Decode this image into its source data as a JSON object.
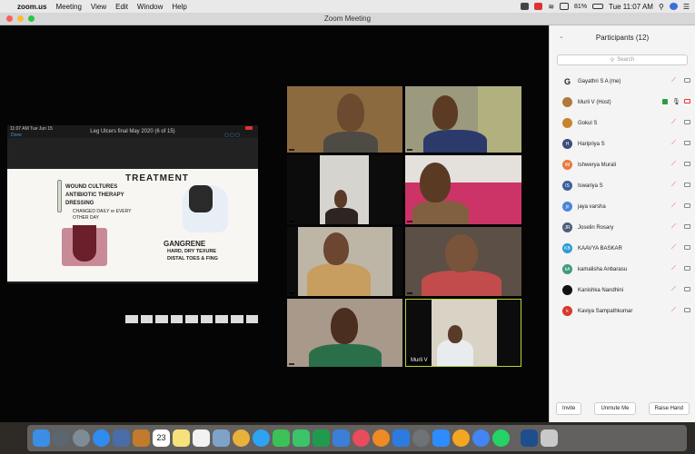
{
  "menubar": {
    "apple": "",
    "app_name": "zoom.us",
    "menus": [
      "Meeting",
      "View",
      "Edit",
      "Window",
      "Help"
    ],
    "battery": "81%",
    "clock": "Tue 11:07 AM"
  },
  "window": {
    "title": "Zoom Meeting"
  },
  "share": {
    "bar_left": "11:07 AM  Tue Jun 15",
    "bar_title": "Leg Ulcers final May 2020 (6 of 15)",
    "done_label": "Done",
    "slide": {
      "heading": "TREATMENT",
      "bullets": [
        "WOUND CULTURES",
        "ANTIBIOTIC THERAPY",
        "DRESSING"
      ],
      "sub_note": "CHANGED DAILY or EVERY OTHER DAY",
      "gangrene_title": "GANGRENE",
      "gangrene_items": [
        "HARD, DRY TEXURE",
        "DISTAL TOES & FING"
      ]
    }
  },
  "tiles": [
    {
      "name": ""
    },
    {
      "name": ""
    },
    {
      "name": ""
    },
    {
      "name": ""
    },
    {
      "name": ""
    },
    {
      "name": ""
    },
    {
      "name": ""
    },
    {
      "name": "Murli V"
    }
  ],
  "participants": {
    "title": "Participants (12)",
    "search_placeholder": "Search",
    "list": [
      {
        "name": "Gayathri S A (me)",
        "initials": "G",
        "color": "#ffffff"
      },
      {
        "name": "Murli V (Host)",
        "initials": "",
        "color": "#b07a3c"
      },
      {
        "name": "Gokul S",
        "initials": "",
        "color": "#c8832f"
      },
      {
        "name": "Haripriya S",
        "initials": "H",
        "color": "#3e4e7a"
      },
      {
        "name": "Ishwerya Murali",
        "initials": "IM",
        "color": "#e87a3a"
      },
      {
        "name": "Iswariya S",
        "initials": "IS",
        "color": "#3d5f9c"
      },
      {
        "name": "jaya varsha",
        "initials": "jv",
        "color": "#4a86d8"
      },
      {
        "name": "Joselin Rosary",
        "initials": "JR",
        "color": "#4f5d7a"
      },
      {
        "name": "KAAVYA BASKAR",
        "initials": "KB",
        "color": "#2a9bd6"
      },
      {
        "name": "kamalisha Anbarasu",
        "initials": "kA",
        "color": "#3d9a7a"
      },
      {
        "name": "Kanishka Nandhini",
        "initials": "",
        "color": "#111111"
      },
      {
        "name": "Kaviya Sampathkumar",
        "initials": "k",
        "color": "#d9382d"
      }
    ],
    "buttons": {
      "invite": "Invite",
      "unmute": "Unmute Me",
      "raise_hand": "Raise Hand"
    }
  },
  "dock": {
    "icons": [
      "finder-icon",
      "launchpad-icon",
      "safari-icon",
      "mail-icon",
      "contacts-icon",
      "calendar-icon",
      "notes-icon",
      "reminders-icon",
      "photos-icon",
      "messages-icon",
      "facetime-icon",
      "maps-icon",
      "numbers-icon",
      "keynote-icon",
      "music-icon",
      "books-icon",
      "appstore-icon",
      "settings-icon",
      "zoom-icon",
      "chrome-icon",
      "whatsapp-icon",
      "preview-icon",
      "trash-icon"
    ],
    "calendar_day": "23"
  }
}
